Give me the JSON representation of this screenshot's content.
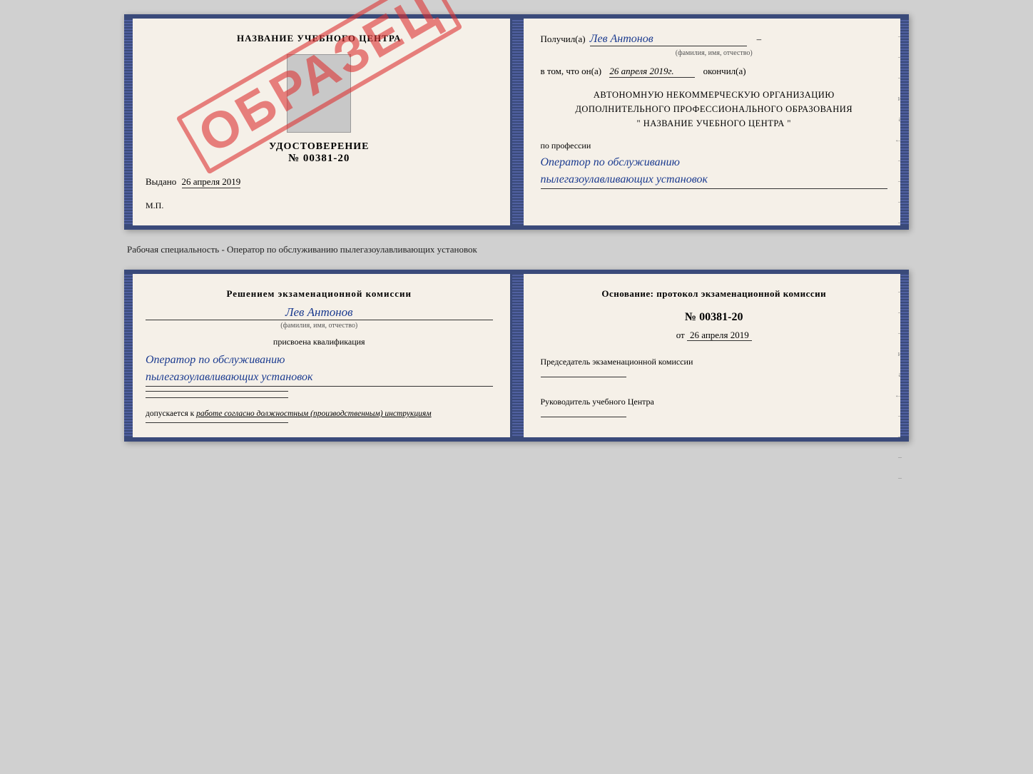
{
  "diploma": {
    "left": {
      "training_center": "НАЗВАНИЕ УЧЕБНОГО ЦЕНТРА",
      "udostoverenie_label": "УДОСТОВЕРЕНИЕ",
      "number": "№ 00381-20",
      "vydano_label": "Выдано",
      "vydano_date": "26 апреля 2019",
      "mp_label": "М.П.",
      "obrazec": "ОБРАЗЕЦ"
    },
    "right": {
      "poluchil_label": "Получил(а)",
      "person_name": "Лев Антонов",
      "fio_hint": "(фамилия, имя, отчество)",
      "v_tom_label": "в том, что он(а)",
      "date": "26 апреля 2019г.",
      "okonchil_label": "окончил(а)",
      "org_line1": "АВТОНОМНУЮ НЕКОММЕРЧЕСКУЮ ОРГАНИЗАЦИЮ",
      "org_line2": "ДОПОЛНИТЕЛЬНОГО ПРОФЕССИОНАЛЬНОГО ОБРАЗОВАНИЯ",
      "org_line3": "\"  НАЗВАНИЕ УЧЕБНОГО ЦЕНТРА  \"",
      "po_professii_label": "по профессии",
      "profession_line1": "Оператор по обслуживанию",
      "profession_line2": "пылегазоулавливающих установок"
    }
  },
  "separator": {
    "text": "Рабочая специальность - Оператор по обслуживанию пылегазоулавливающих установок"
  },
  "qualification": {
    "left": {
      "resheniem_label": "Решением экзаменационной комиссии",
      "person_name": "Лев Антонов",
      "fio_hint": "(фамилия, имя, отчество)",
      "prisvoena_label": "присвоена квалификация",
      "kval_line1": "Оператор по обслуживанию",
      "kval_line2": "пылегазоулавливающих установок",
      "dopuskaetsya_label": "допускается к",
      "dopusk_text": "работе согласно должностным (производственным) инструкциям"
    },
    "right": {
      "osnovanie_label": "Основание: протокол экзаменационной комиссии",
      "protocol_number": "№ 00381-20",
      "ot_label": "от",
      "ot_date": "26 апреля 2019",
      "predsedatel_label": "Председатель экзаменационной комиссии",
      "rukovoditel_label": "Руководитель учебного Центра"
    }
  },
  "binding_chars": [
    "–",
    "–",
    "–",
    "и",
    "а",
    "←",
    "–",
    "–",
    "–",
    "–"
  ]
}
